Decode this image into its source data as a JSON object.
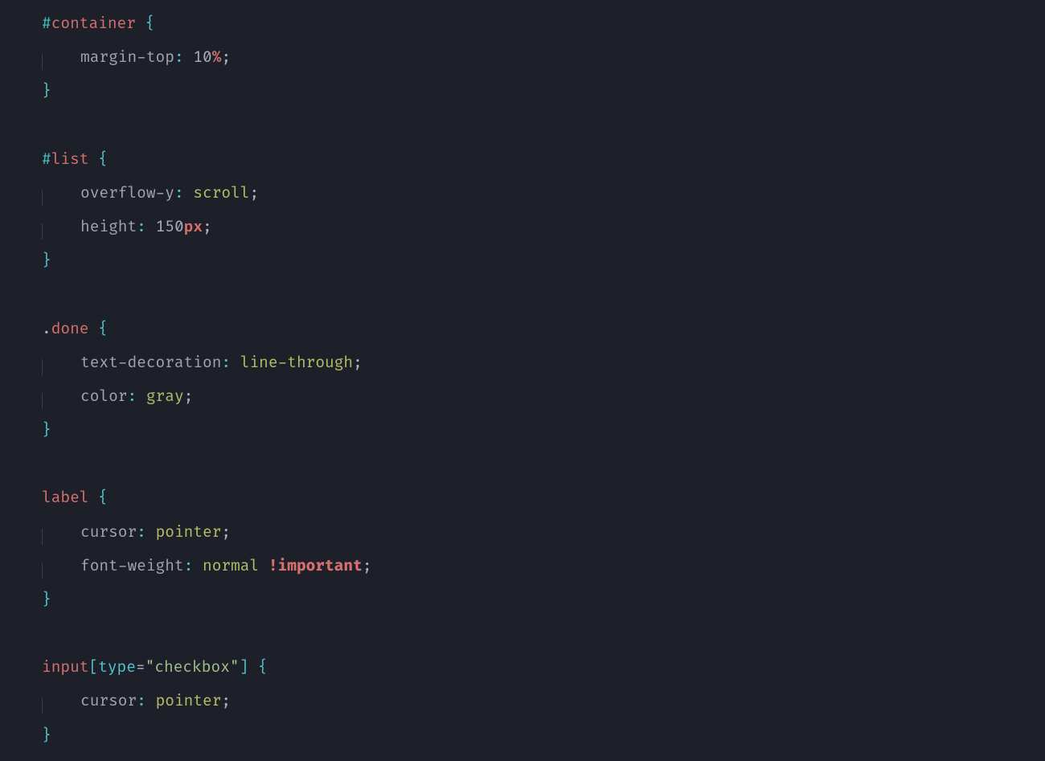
{
  "language": "css",
  "theme": "dark",
  "rules": [
    {
      "selector": {
        "prefix": "#",
        "name": "container"
      },
      "declarations": [
        {
          "property": "margin-top",
          "value": "10",
          "unit": "%"
        }
      ]
    },
    {
      "selector": {
        "prefix": "#",
        "name": "list"
      },
      "declarations": [
        {
          "property": "overflow-y",
          "value": "scroll"
        },
        {
          "property": "height",
          "value": "150",
          "unit": "px"
        }
      ]
    },
    {
      "selector": {
        "prefix": ".",
        "name": "done"
      },
      "declarations": [
        {
          "property": "text-decoration",
          "value": "line-through"
        },
        {
          "property": "color",
          "value": "gray"
        }
      ]
    },
    {
      "selector": {
        "tag": "label"
      },
      "declarations": [
        {
          "property": "cursor",
          "value": "pointer"
        },
        {
          "property": "font-weight",
          "value": "normal",
          "important": "!important"
        }
      ]
    },
    {
      "selector": {
        "tag": "input",
        "attr": "type",
        "attr_value": "\"checkbox\""
      },
      "declarations": [
        {
          "property": "cursor",
          "value": "pointer"
        }
      ]
    }
  ]
}
